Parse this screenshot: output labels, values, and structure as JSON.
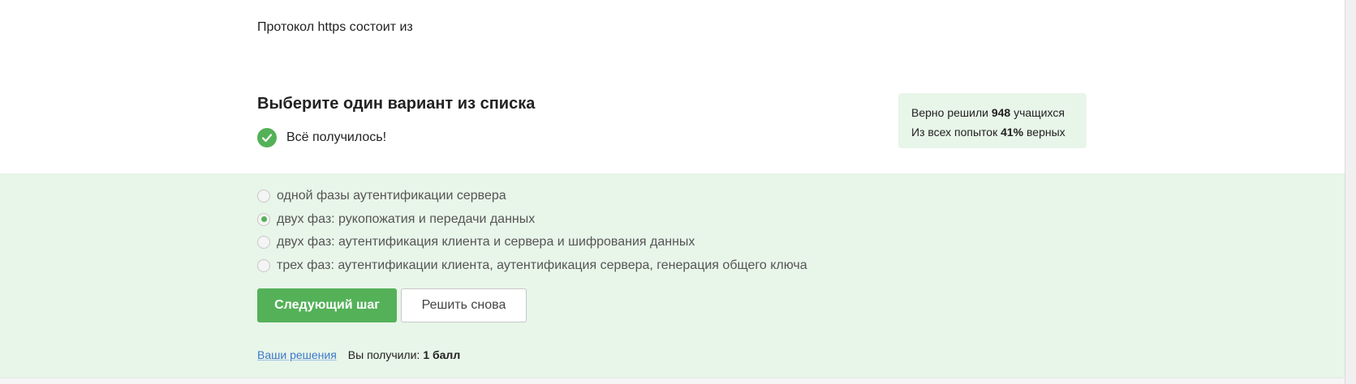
{
  "question": {
    "text": "Протокол https состоит из"
  },
  "task": {
    "title": "Выберите один вариант из списка",
    "status_text": "Всё получилось!",
    "status_icon": "check-circle-icon"
  },
  "stats": {
    "line1_prefix": "Верно решили",
    "solved_count": "948",
    "line1_suffix": "учащихся",
    "line2_prefix": "Из всех попыток",
    "correct_percent": "41%",
    "line2_suffix": "верных"
  },
  "options": [
    {
      "label": "одной фазы аутентификации сервера",
      "selected": false
    },
    {
      "label": "двух фаз: рукопожатия и передачи данных",
      "selected": true
    },
    {
      "label": "двух фаз: аутентификация клиента и сервера и шифрования данных",
      "selected": false
    },
    {
      "label": "трех фаз: аутентификации клиента, аутентификация сервера, генерация общего ключа",
      "selected": false
    }
  ],
  "buttons": {
    "next_label": "Следующий шаг",
    "retry_label": "Решить снова"
  },
  "footer": {
    "solutions_link": "Ваши решения",
    "score_label": "Вы получили:",
    "score_value": "1 балл"
  },
  "colors": {
    "accent": "#54b158",
    "answer_bg": "#e8f5e9",
    "link": "#3b79c9"
  }
}
